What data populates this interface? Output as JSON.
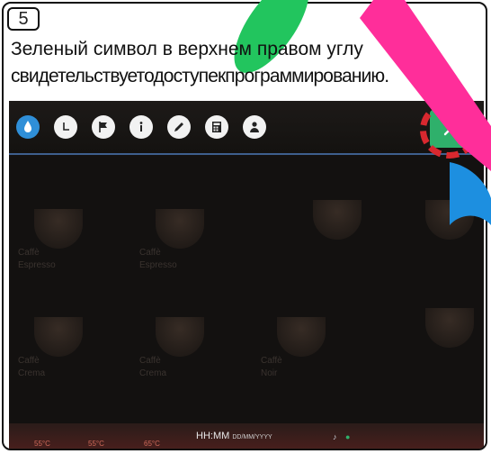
{
  "step_number": "5",
  "caption": {
    "line1": "Зеленый символ в верхнем правом углу",
    "line2": "свидетельствуетодоступекпрограммированию."
  },
  "toolbar": {
    "buttons": [
      {
        "icon": "water-drop-icon"
      },
      {
        "icon": "clock-icon"
      },
      {
        "icon": "flag-icon"
      },
      {
        "icon": "info-icon"
      },
      {
        "icon": "pencil-icon"
      },
      {
        "icon": "calculator-icon"
      },
      {
        "icon": "user-icon"
      }
    ],
    "settings_icon": "wrench-icon",
    "settings_color": "#2fb06b",
    "highlight_color": "#d8282f"
  },
  "drinks": [
    {
      "label": "Caffè\nEspresso"
    },
    {
      "label": "Caffè\nEspresso"
    },
    {
      "label": "Caffè\nCrema"
    },
    {
      "label": "Caffè\nCrema"
    },
    {
      "label": "Caffè\nNoir"
    }
  ],
  "status_bar": {
    "time": "HH:MM",
    "date": "DD/MM/YYYY",
    "temps": [
      "55°C",
      "55°C",
      "65°C"
    ]
  }
}
